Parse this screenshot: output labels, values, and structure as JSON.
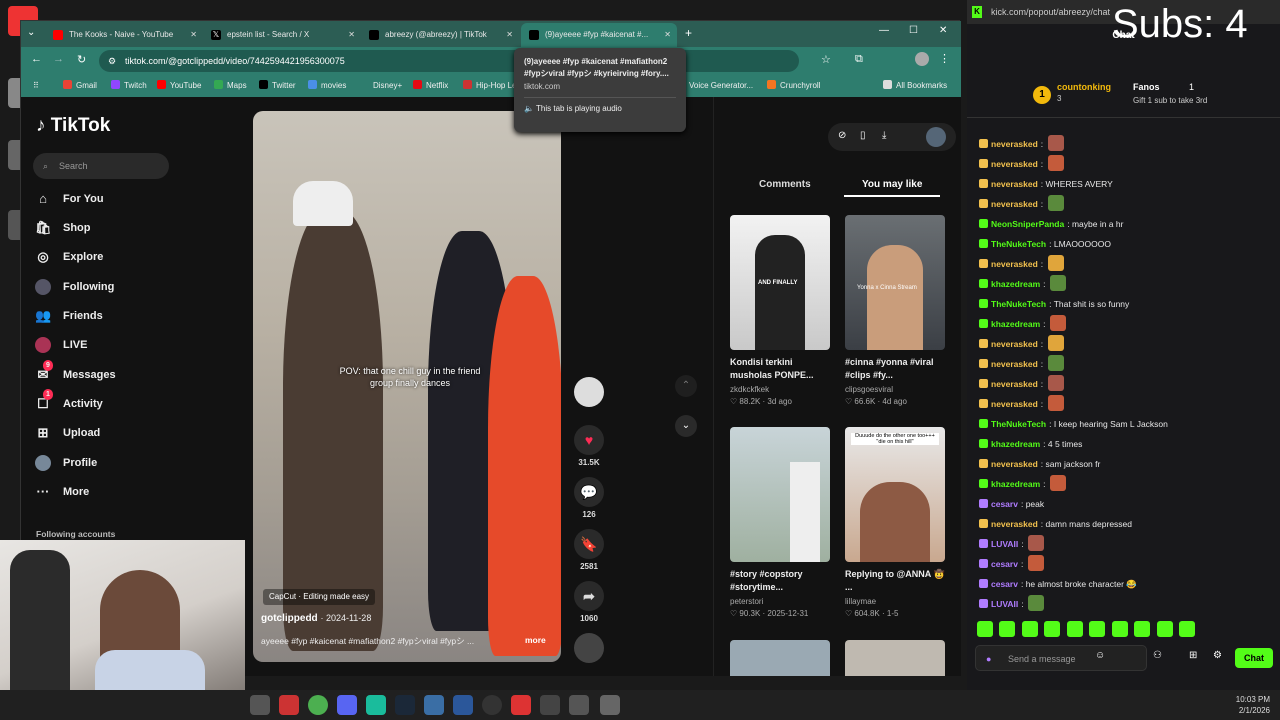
{
  "browser": {
    "tabs": [
      {
        "title": "The Kooks - Naive - YouTube",
        "icon": "youtube-icon",
        "color": "#ff0000"
      },
      {
        "title": "epstein list - Search / X",
        "icon": "x-icon",
        "color": "#000000"
      },
      {
        "title": "abreezy (@abreezy) | TikTok",
        "icon": "tiktok-icon",
        "color": "#000000"
      },
      {
        "title": "(9)ayeeee #fyp #kaicenat #...",
        "icon": "tiktok-icon",
        "color": "#000000"
      }
    ],
    "url": "tiktok.com/@gotclippedd/video/7442594421956300075",
    "bookmarks": [
      "Gmail",
      "Twitch",
      "YouTube",
      "Maps",
      "Twitter",
      "movies",
      "Disney+",
      "Netflix",
      "Hip-Hop Le...",
      "Voice Generator...",
      "Crunchyroll"
    ],
    "all_bookmarks": "All Bookmarks",
    "tooltip": {
      "title": "(9)ayeeee #fyp #kaicenat #mafiathon2 #fypシviral #fypシ #kyrieirving #fory....",
      "domain": "tiktok.com",
      "audio": "This tab is playing audio"
    }
  },
  "tiktok": {
    "logo": "TikTok",
    "search_placeholder": "Search",
    "nav": [
      {
        "label": "For You",
        "icon": "home-icon"
      },
      {
        "label": "Shop",
        "icon": "shop-icon"
      },
      {
        "label": "Explore",
        "icon": "compass-icon"
      },
      {
        "label": "Following",
        "icon": "following-icon"
      },
      {
        "label": "Friends",
        "icon": "friends-icon"
      },
      {
        "label": "LIVE",
        "icon": "live-icon"
      },
      {
        "label": "Messages",
        "icon": "messages-icon",
        "badge": "9"
      },
      {
        "label": "Activity",
        "icon": "activity-icon",
        "badge": "1"
      },
      {
        "label": "Upload",
        "icon": "upload-icon"
      },
      {
        "label": "Profile",
        "icon": "profile-icon"
      },
      {
        "label": "More",
        "icon": "more-icon"
      }
    ],
    "following_accounts": "Following accounts",
    "video": {
      "caption_overlay": "POV: that one chill guy in the friend group finally dances",
      "capcut": "CapCut · Editing made easy",
      "author": "gotclippedd",
      "date": "2024-11-28",
      "description": "ayeeee #fyp #kaicenat #mafiathon2 #fypシviral #fypシ ...",
      "more": "more"
    },
    "actions": {
      "likes": "31.5K",
      "comments": "126",
      "saves": "2581",
      "shares": "1060"
    },
    "right_tabs": {
      "comments": "Comments",
      "you_may_like": "You may like"
    },
    "cards": [
      {
        "title": "Kondisi terkini musholas PONPE...",
        "user": "zkdkckfkek",
        "likes": "88.2K",
        "date": "3d ago",
        "overlay": "AND FINALLY"
      },
      {
        "title": "#cinna #yonna #viral #clips #fy...",
        "user": "clipsgoesviral",
        "likes": "66.6K",
        "date": "4d ago",
        "overlay": "Yonna x Cinna Stream"
      },
      {
        "title": "#story #copstory #storytime...",
        "user": "peterstori",
        "likes": "90.3K",
        "date": "2025-12-31",
        "overlay": ""
      },
      {
        "title": "Replying to @ANNA 🤠 ...",
        "user": "lillaymae",
        "likes": "604.8K",
        "date": "1-5",
        "overlay": "Duuude do the other one too+++ \"die on this hill\""
      }
    ]
  },
  "chat": {
    "url": "kick.com/popout/abreezy/chat",
    "title": "Chat",
    "top_gifter": {
      "name": "countonking",
      "count": "3",
      "rank": "1"
    },
    "fanos": {
      "label": "Fanos",
      "count": "1",
      "sub": "Gift 1 sub to take 3rd"
    },
    "messages": [
      {
        "user": "neverasked",
        "text": "",
        "color": "#f2c14e"
      },
      {
        "user": "neverasked",
        "text": "",
        "color": "#f2c14e"
      },
      {
        "user": "neverasked",
        "text": "WHERES AVERY",
        "color": "#f2c14e"
      },
      {
        "user": "neverasked",
        "text": "",
        "color": "#f2c14e"
      },
      {
        "user": "NeonSniperPanda",
        "text": "maybe in a hr",
        "color": "#53fc18"
      },
      {
        "user": "TheNukeTech",
        "text": "LMAOOOOOO",
        "color": "#53fc18"
      },
      {
        "user": "neverasked",
        "text": "",
        "color": "#f2c14e"
      },
      {
        "user": "khazedream",
        "text": "",
        "color": "#53fc18"
      },
      {
        "user": "TheNukeTech",
        "text": "That shit is so funny",
        "color": "#53fc18"
      },
      {
        "user": "khazedream",
        "text": "",
        "color": "#53fc18"
      },
      {
        "user": "neverasked",
        "text": "",
        "color": "#f2c14e"
      },
      {
        "user": "neverasked",
        "text": "",
        "color": "#f2c14e"
      },
      {
        "user": "neverasked",
        "text": "",
        "color": "#f2c14e"
      },
      {
        "user": "neverasked",
        "text": "",
        "color": "#f2c14e"
      },
      {
        "user": "TheNukeTech",
        "text": "I keep hearing Sam L Jackson",
        "color": "#53fc18"
      },
      {
        "user": "khazedream",
        "text": "4 5 times",
        "color": "#53fc18"
      },
      {
        "user": "neverasked",
        "text": "sam jackson fr",
        "color": "#f2c14e"
      },
      {
        "user": "khazedream",
        "text": "",
        "color": "#53fc18"
      },
      {
        "user": "cesarv",
        "text": "peak",
        "color": "#b07cff"
      },
      {
        "user": "neverasked",
        "text": "damn mans depressed",
        "color": "#f2c14e"
      },
      {
        "user": "LUVAII",
        "text": "",
        "color": "#b07cff"
      },
      {
        "user": "cesarv",
        "text": "",
        "color": "#b07cff"
      },
      {
        "user": "cesarv",
        "text": "he almost broke character 😂",
        "color": "#b07cff"
      },
      {
        "user": "LUVAII",
        "text": "",
        "color": "#b07cff"
      }
    ],
    "input_placeholder": "Send a message",
    "send_label": "Chat"
  },
  "overlay": {
    "subs": "Subs: 4"
  },
  "taskbar": {
    "time": "10:03 PM",
    "date": "2/1/2026"
  }
}
